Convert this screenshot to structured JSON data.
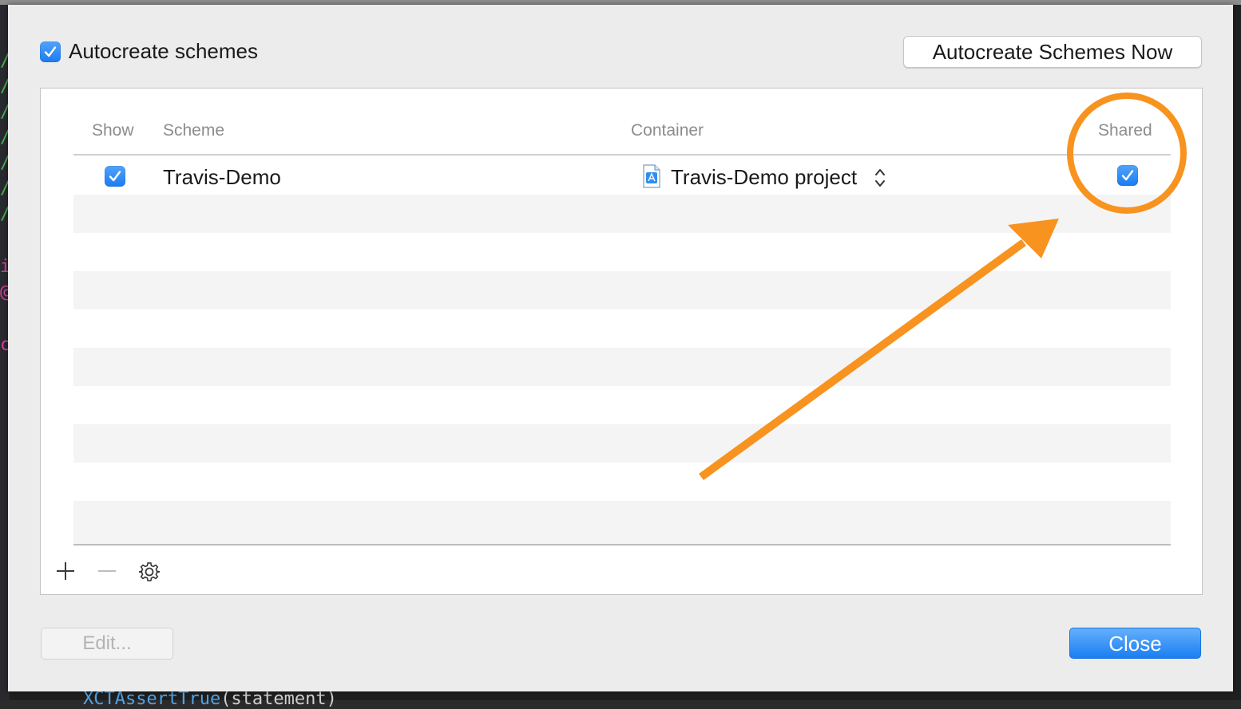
{
  "background": {
    "editor_glyphs": [
      "/",
      "/",
      "/",
      "/",
      "/",
      "/",
      "/",
      "i",
      "@",
      "c"
    ],
    "bottom_code": "XCTAssertTrue(statement)"
  },
  "options": {
    "autocreate_label": "Autocreate schemes",
    "autocreate_checked": true,
    "autocreate_now_label": "Autocreate Schemes Now"
  },
  "table": {
    "columns": {
      "show": "Show",
      "scheme": "Scheme",
      "container": "Container",
      "shared": "Shared"
    },
    "rows": [
      {
        "show": true,
        "scheme": "Travis-Demo",
        "container": "Travis-Demo project",
        "container_icon": "xcode-project-icon",
        "shared": true
      }
    ]
  },
  "toolbar": {
    "add_icon": "plus-icon",
    "remove_icon": "minus-icon",
    "settings_icon": "gear-icon"
  },
  "footer": {
    "edit_label": "Edit...",
    "close_label": "Close"
  },
  "colors": {
    "accent": "#1a7ef4",
    "annotation": "#f7931e"
  }
}
